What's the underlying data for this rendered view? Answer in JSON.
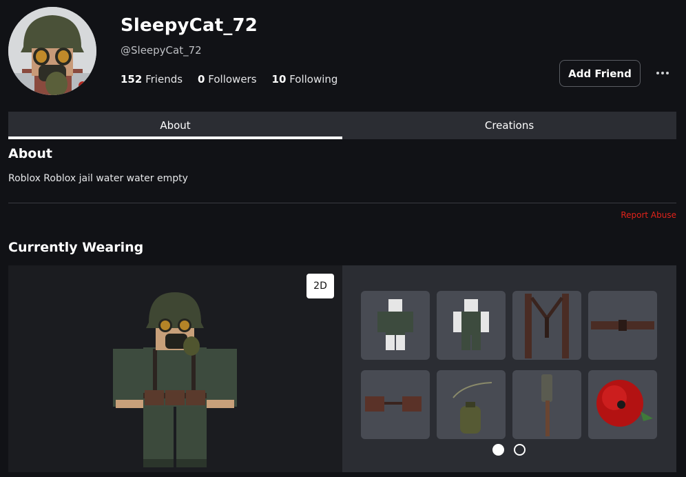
{
  "profile": {
    "display_name": "SleepyCat_72",
    "username": "@SleepyCat_72",
    "friends_count": "152",
    "friends_label": "Friends",
    "followers_count": "0",
    "followers_label": "Followers",
    "following_count": "10",
    "following_label": "Following",
    "avatar_icon": "avatar-headshot"
  },
  "actions": {
    "add_friend_label": "Add Friend",
    "more_icon": "ellipsis-icon"
  },
  "tabs": [
    {
      "label": "About",
      "active": true
    },
    {
      "label": "Creations",
      "active": false
    }
  ],
  "about": {
    "heading": "About",
    "description": "Roblox Roblox jail water water empty",
    "report_label": "Report Abuse"
  },
  "wearing": {
    "heading": "Currently Wearing",
    "view_toggle_label": "2D",
    "items": [
      {
        "icon": "shirt-item"
      },
      {
        "icon": "pants-item"
      },
      {
        "icon": "suspenders-item"
      },
      {
        "icon": "belt-item"
      },
      {
        "icon": "pouches-item"
      },
      {
        "icon": "canteen-item"
      },
      {
        "icon": "shovel-item"
      },
      {
        "icon": "poppy-item"
      }
    ],
    "pages": [
      {
        "active": true
      },
      {
        "active": false
      }
    ]
  },
  "colors": {
    "background": "#111216",
    "tab_bar": "#2b2d33",
    "item_tile": "#484b53",
    "report_red": "#e2231a"
  }
}
